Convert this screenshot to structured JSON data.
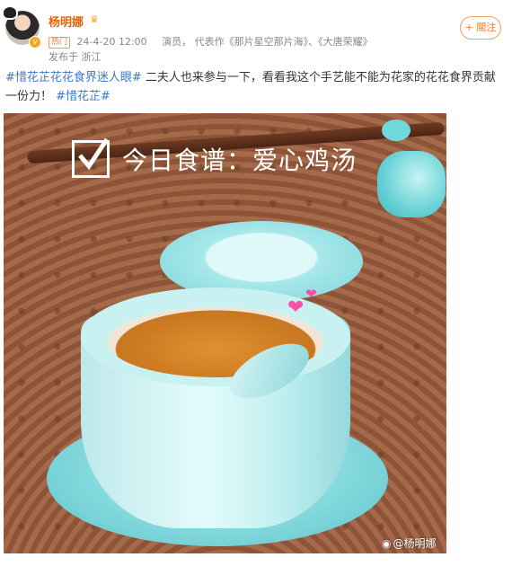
{
  "post": {
    "author": "杨明娜",
    "hot_tag": "热门",
    "date_time": "24-4-20 12:00",
    "role": "演员",
    "works": "代表作《那片星空那片海》、《大唐荣耀》",
    "location": "发布于 浙江",
    "follow_label": "+ 關注",
    "text_parts": [
      {
        "type": "tag",
        "text": "#惜花芷花花食界迷人眼#"
      },
      {
        "type": "text",
        "text": " 二夫人也来参与一下，看看我这个手艺能不能为花家的花花食界贡献一份力！ "
      },
      {
        "type": "tag",
        "text": "#惜花芷#"
      }
    ]
  },
  "image": {
    "overlay_title": "今日食谱：爱心鸡汤",
    "watermark": "@杨明娜"
  },
  "icons": {
    "avatar_badge": "v-badge-icon",
    "crown": "crown-icon",
    "checkbox": "checkbox-icon",
    "heart": "heart-icon",
    "watermark": "weibo-logo-icon"
  },
  "colors": {
    "username": "#e8630a",
    "tag": "#3a79c7",
    "follow": "#f07b2a"
  }
}
